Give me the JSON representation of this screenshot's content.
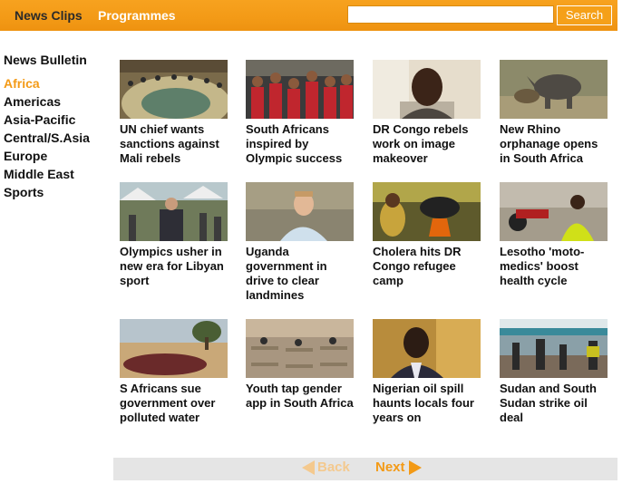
{
  "nav": {
    "news_clips": "News Clips",
    "programmes": "Programmes"
  },
  "search": {
    "value": "",
    "button": "Search"
  },
  "sidebar": {
    "heading": "News Bulletin",
    "items": [
      {
        "label": "Africa",
        "active": true
      },
      {
        "label": "Americas"
      },
      {
        "label": "Asia-Pacific"
      },
      {
        "label": "Central/S.Asia"
      },
      {
        "label": "Europe"
      },
      {
        "label": "Middle East"
      },
      {
        "label": "Sports"
      }
    ]
  },
  "clips": [
    {
      "title": "UN chief wants sanctions against Mali rebels",
      "thumb": "un-council-chamber"
    },
    {
      "title": "South Africans inspired by Olympic success",
      "thumb": "crowd-in-red"
    },
    {
      "title": "DR Congo rebels work on image makeover",
      "thumb": "man-interview"
    },
    {
      "title": "New Rhino orphanage opens in South Africa",
      "thumb": "rhino"
    },
    {
      "title": "Olympics usher in new era for Libyan sport",
      "thumb": "reporter-outdoors"
    },
    {
      "title": "Uganda government in drive to clear landmines",
      "thumb": "man-blue-shirt"
    },
    {
      "title": "Cholera hits DR Congo refugee camp",
      "thumb": "cooking-pot"
    },
    {
      "title": "Lesotho 'moto-medics' boost health cycle",
      "thumb": "motorbike-medic"
    },
    {
      "title": "S Africans sue government over polluted water",
      "thumb": "polluted-water"
    },
    {
      "title": "Youth tap gender app in South Africa",
      "thumb": "classroom"
    },
    {
      "title": "Nigerian oil spill haunts locals four years on",
      "thumb": "man-suit"
    },
    {
      "title": "Sudan and South Sudan strike oil deal",
      "thumb": "street-market"
    }
  ],
  "pager": {
    "back": "Back",
    "next": "Next"
  },
  "colors": {
    "accent": "#f39a16",
    "disabled": "#f4c98e"
  }
}
